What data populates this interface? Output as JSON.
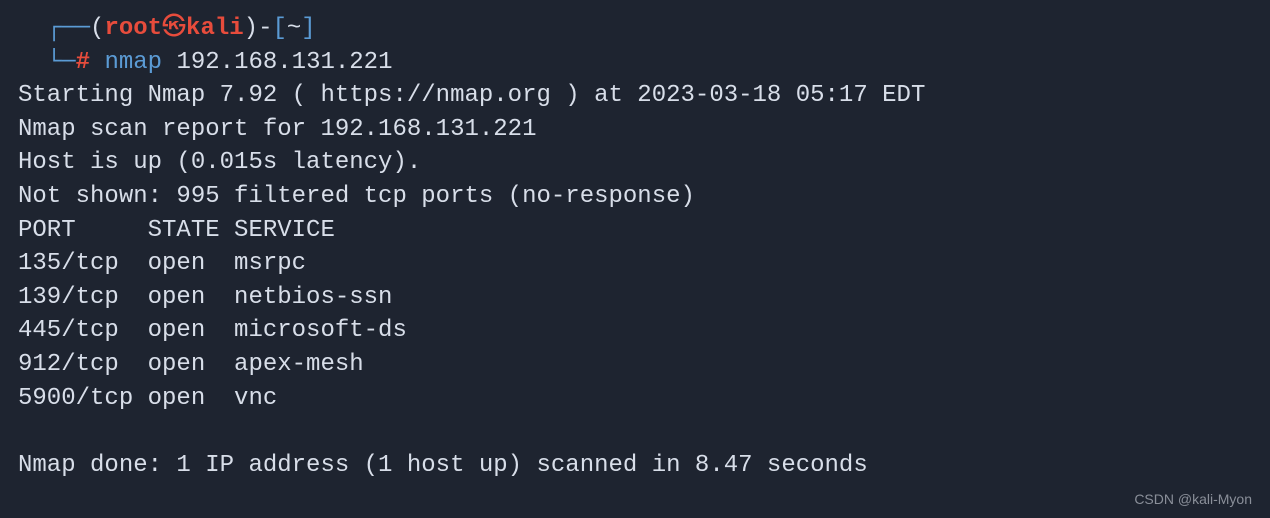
{
  "prompt": {
    "corner_top": "┌──",
    "paren_open": "(",
    "user": "root",
    "separator_icon": "㉿",
    "host": "kali",
    "paren_close": ")",
    "dash": "-",
    "bracket_open": "[",
    "cwd": "~",
    "bracket_close": "]",
    "corner_bottom": "└─",
    "hash": "#",
    "command": "nmap",
    "args": "192.168.131.221"
  },
  "output": {
    "starting": "Starting Nmap 7.92 ( https://nmap.org ) at 2023-03-18 05:17 EDT",
    "scan_report": "Nmap scan report for 192.168.131.221",
    "host_status": "Host is up (0.015s latency).",
    "not_shown": "Not shown: 995 filtered tcp ports (no-response)",
    "header": "PORT     STATE SERVICE",
    "ports": [
      "135/tcp  open  msrpc",
      "139/tcp  open  netbios-ssn",
      "445/tcp  open  microsoft-ds",
      "912/tcp  open  apex-mesh",
      "5900/tcp open  vnc"
    ],
    "blank": " ",
    "done": "Nmap done: 1 IP address (1 host up) scanned in 8.47 seconds"
  },
  "watermark": "CSDN @kali-Myon"
}
